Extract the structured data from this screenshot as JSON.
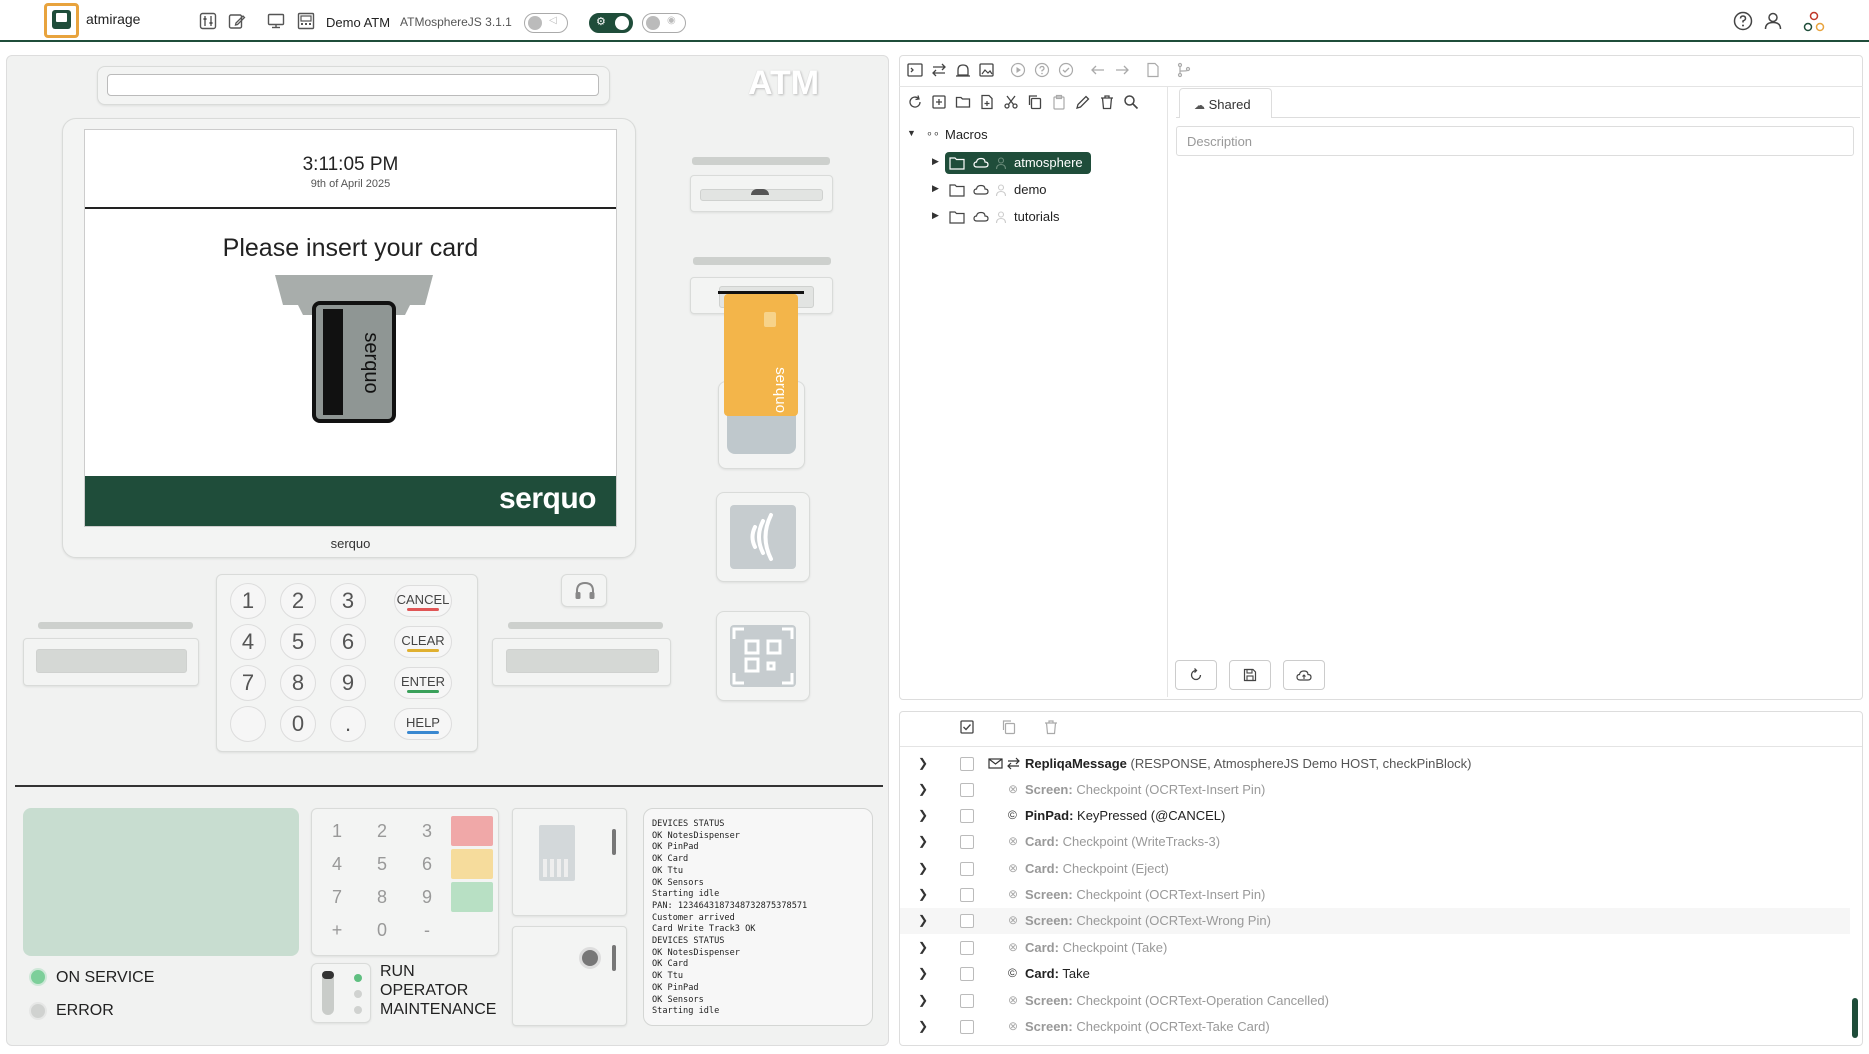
{
  "topbar": {
    "app_name": "atmirage",
    "title": "Demo ATM",
    "version": "ATMosphereJS 3.1.1"
  },
  "atm": {
    "brand_watermark": "ATM",
    "screen": {
      "time": "3:11:05 PM",
      "date": "9th of April 2025",
      "message": "Please insert your card",
      "brand": "serquo"
    },
    "under_screen_brand": "serquo",
    "card_brand": "serquo",
    "keypad": {
      "keys": [
        "1",
        "2",
        "3",
        "4",
        "5",
        "6",
        "7",
        "8",
        "9",
        "",
        "0",
        "."
      ],
      "cancel": "CANCEL",
      "clear": "CLEAR",
      "enter": "ENTER",
      "help": "HELP"
    },
    "mini_keypad": [
      "1",
      "2",
      "3",
      "4",
      "5",
      "6",
      "7",
      "8",
      "9",
      "+",
      "0",
      "-"
    ],
    "status": {
      "on_service": "ON SERVICE",
      "error": "ERROR"
    },
    "modes": {
      "run": "RUN",
      "operator": "OPERATOR",
      "maintenance": "MAINTENANCE"
    },
    "log": "DEVICES STATUS\nOK NotesDispenser\nOK PinPad\nOK Card\nOK Ttu\nOK Sensors\nStarting idle\nPAN: 1234643187348732875378571\nCustomer arrived\nCard Write Track3 OK\nDEVICES STATUS\nOK NotesDispenser\nOK Card\nOK Ttu\nOK PinPad\nOK Sensors\nStarting idle"
  },
  "macros": {
    "root": "Macros",
    "folders": [
      "atmosphere",
      "demo",
      "tutorials"
    ],
    "tab": "Shared",
    "description_placeholder": "Description"
  },
  "log_entries": [
    {
      "source": "RepliqaMessage",
      "text": "(RESPONSE, AtmosphereJS Demo HOST, checkPinBlock)",
      "style": "dark"
    },
    {
      "source": "Screen:",
      "text": "Checkpoint (OCRText-Insert Pin)",
      "style": "gray"
    },
    {
      "source": "PinPad:",
      "text": "KeyPressed (@CANCEL)",
      "style": "dark"
    },
    {
      "source": "Card:",
      "text": "Checkpoint (WriteTracks-3)",
      "style": "gray"
    },
    {
      "source": "Card:",
      "text": "Checkpoint (Eject)",
      "style": "gray"
    },
    {
      "source": "Screen:",
      "text": "Checkpoint (OCRText-Insert Pin)",
      "style": "gray"
    },
    {
      "source": "Screen:",
      "text": "Checkpoint (OCRText-Wrong Pin)",
      "style": "gray"
    },
    {
      "source": "Card:",
      "text": "Checkpoint (Take)",
      "style": "gray"
    },
    {
      "source": "Card:",
      "text": "Take",
      "style": "dark"
    },
    {
      "source": "Screen:",
      "text": "Checkpoint (OCRText-Operation Cancelled)",
      "style": "gray"
    },
    {
      "source": "Screen:",
      "text": "Checkpoint (OCRText-Take Card)",
      "style": "gray"
    }
  ],
  "colors": {
    "brand_green": "#1f4d3a",
    "logo_orange": "#e8a33d",
    "cancel": "#e05555",
    "clear": "#e0b030",
    "enter": "#3aa05a",
    "help": "#3a88d0",
    "card": "#f3b54a"
  }
}
